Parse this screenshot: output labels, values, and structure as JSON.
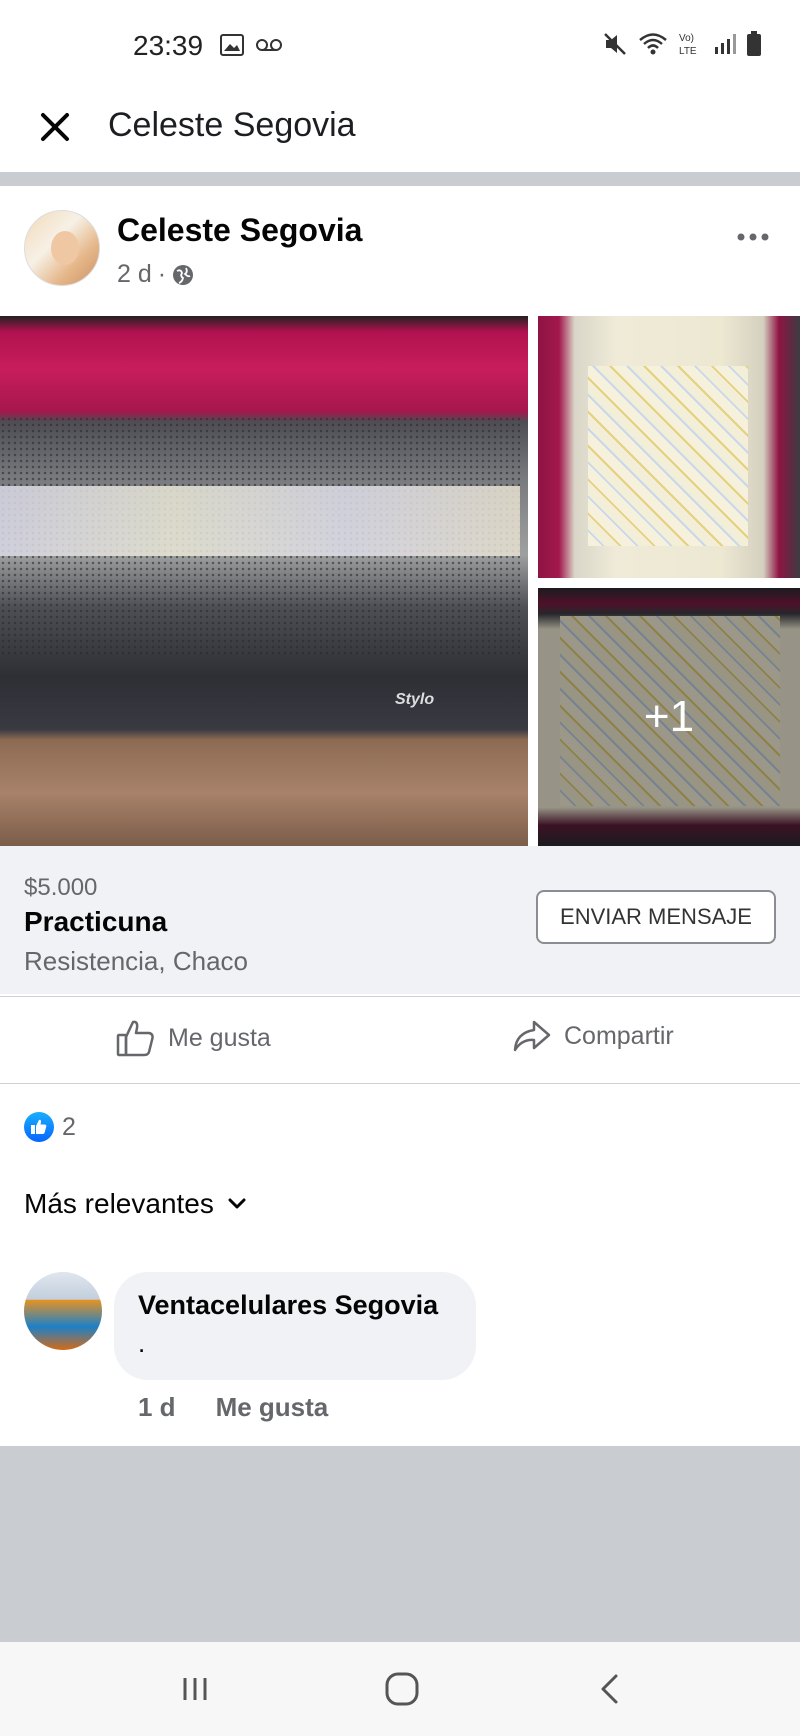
{
  "status_bar": {
    "time": "23:39"
  },
  "header": {
    "title": "Celeste Segovia"
  },
  "post": {
    "author": "Celeste Segovia",
    "time": "2 d",
    "dot": "·",
    "photos_more": "+1",
    "photo_brand": "Stylo"
  },
  "listing": {
    "price": "$5.000",
    "title": "Practicuna",
    "location": "Resistencia, Chaco",
    "message_button": "ENVIAR MENSAJE"
  },
  "actions": {
    "like": "Me gusta",
    "share": "Compartir"
  },
  "reactions": {
    "count": "2"
  },
  "comments": {
    "sort_label": "Más relevantes",
    "items": [
      {
        "author": "Ventacelulares Segovia",
        "text": ".",
        "time": "1 d",
        "like": "Me gusta"
      }
    ]
  },
  "colors": {
    "accent": "#0866ff",
    "secondary_text": "#65676b",
    "separator": "#c9ccd1"
  }
}
